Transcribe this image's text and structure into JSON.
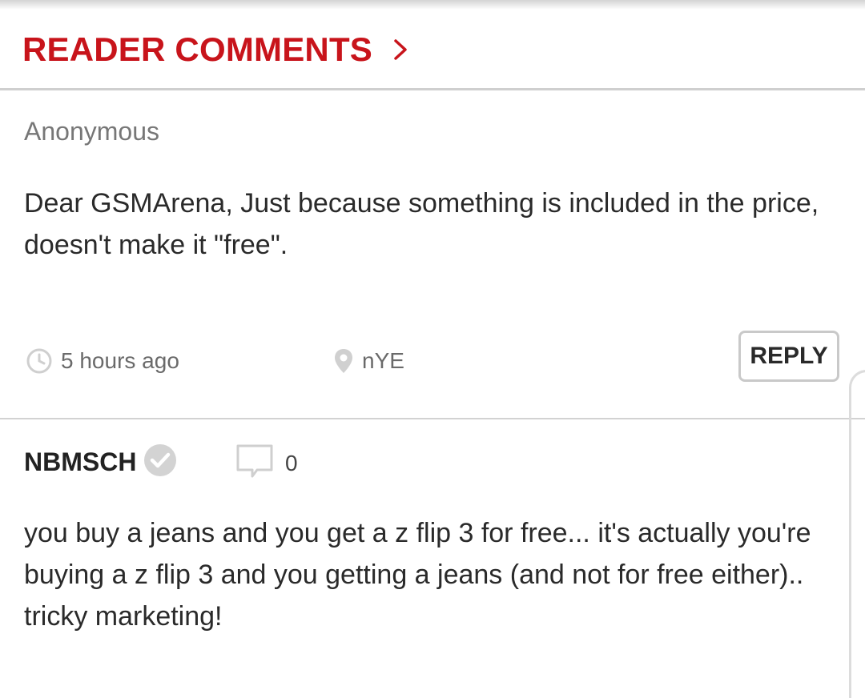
{
  "header": {
    "title": "READER COMMENTS",
    "title_color": "#c8141b",
    "chevron_icon": "chevron-right-icon"
  },
  "comments": [
    {
      "author": "Anonymous",
      "text": "Dear GSMArena, Just because something is included in the price, doesn't make it \"free\".",
      "time": "5 hours ago",
      "location": "nYE",
      "reply_label": "REPLY",
      "time_icon": "clock-icon",
      "location_icon": "location-pin-icon"
    },
    {
      "author": "NBMSCH",
      "verified_icon": "verified-check-icon",
      "rating_icon": "comment-rating-icon",
      "rating_count": "0",
      "text": "you buy a jeans and you get a z flip 3 for free... it's actually you're buying a z flip 3 and you getting a jeans (and not for free either).. tricky marketing!"
    }
  ]
}
